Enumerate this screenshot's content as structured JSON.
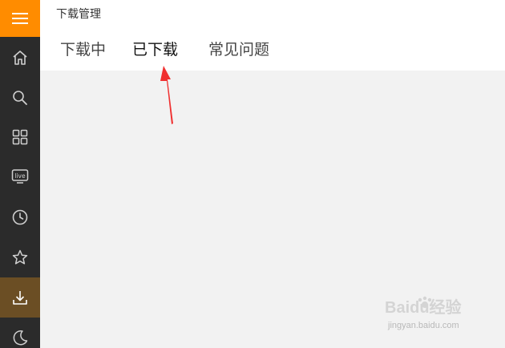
{
  "window": {
    "title": "下载管理"
  },
  "tabs": [
    {
      "label": "下载中",
      "active": false
    },
    {
      "label": "已下载",
      "active": true
    },
    {
      "label": "常见问题",
      "active": false
    }
  ],
  "sidebar": {
    "menu_icon": "hamburger-icon",
    "accent_color": "#ff8c00",
    "items": [
      {
        "icon": "home-icon",
        "active": false
      },
      {
        "icon": "search-icon",
        "active": false
      },
      {
        "icon": "grid-icon",
        "active": false
      },
      {
        "icon": "live-tv-icon",
        "label": "live",
        "active": false
      },
      {
        "icon": "clock-icon",
        "active": false
      },
      {
        "icon": "star-icon",
        "active": false
      },
      {
        "icon": "download-icon",
        "active": true
      },
      {
        "icon": "moon-icon",
        "active": false
      }
    ]
  },
  "watermark": {
    "logo_text": "Baidu经验",
    "sub_text": "jingyan.baidu.com"
  }
}
